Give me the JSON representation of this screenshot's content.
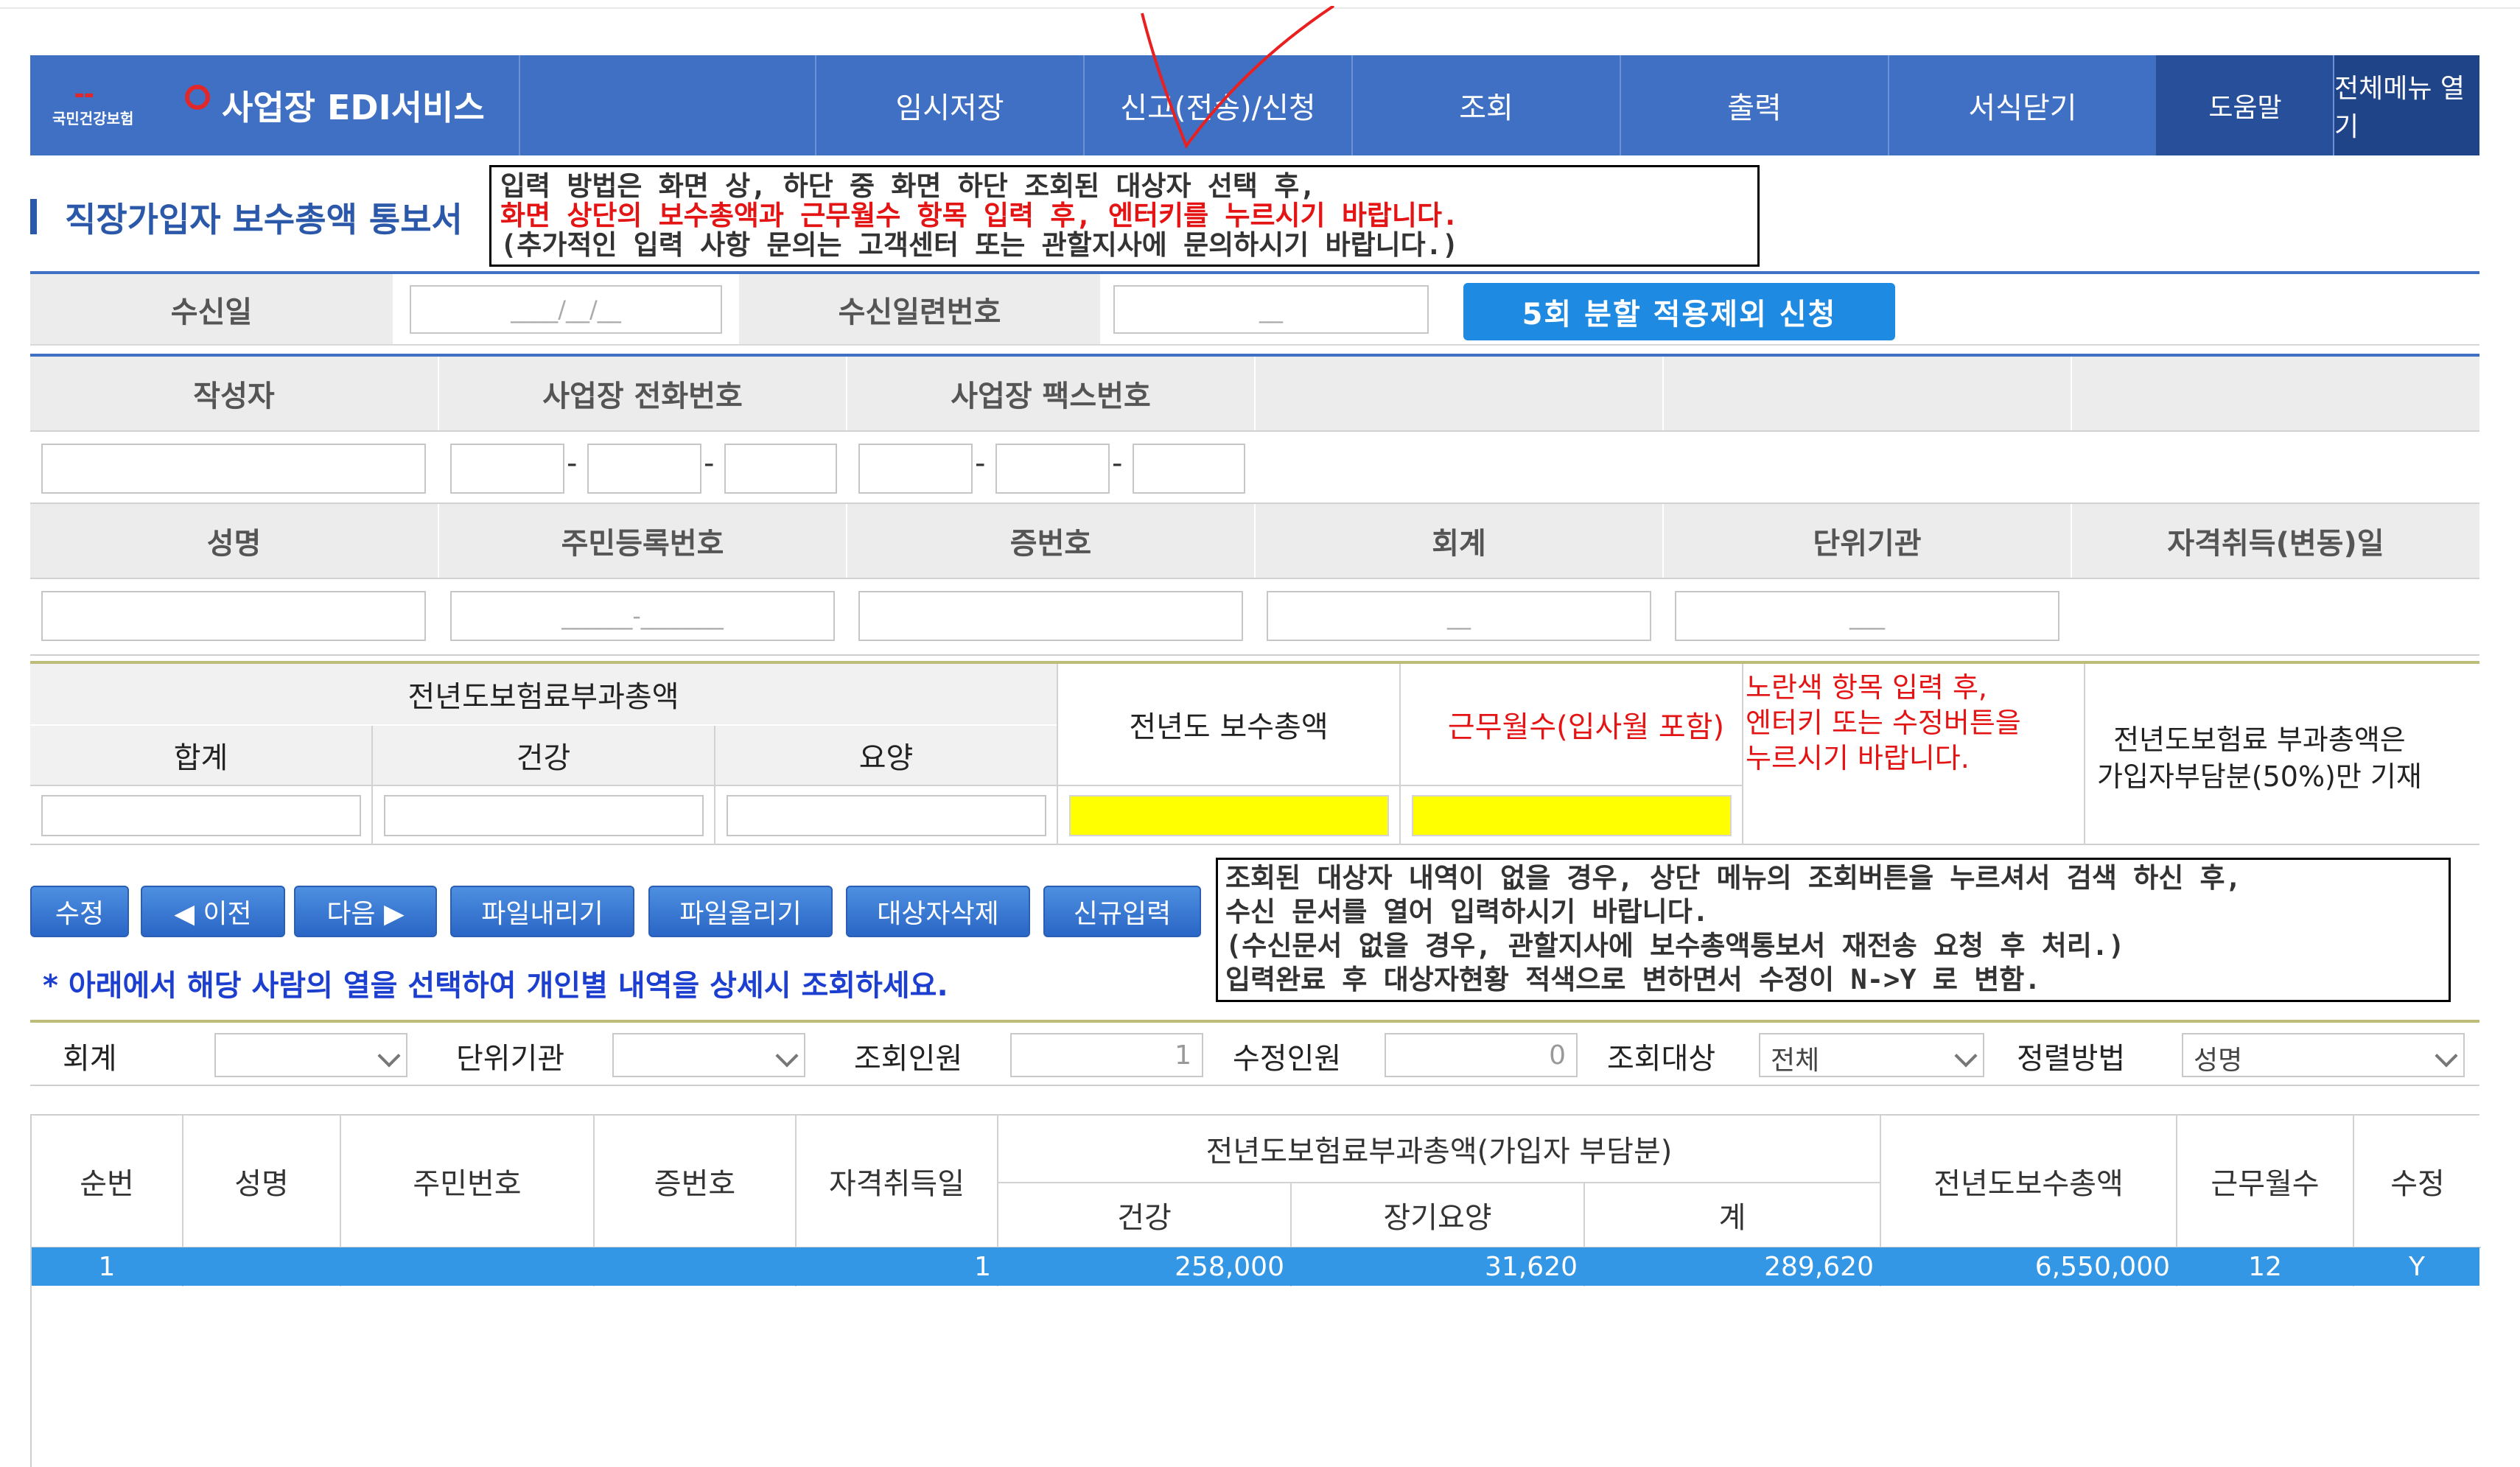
{
  "header": {
    "logo_text": "국민건강보험",
    "app_title": "사업장 EDI서비스",
    "menu": [
      "임시저장",
      "신고(전송)/신청",
      "조회",
      "출력",
      "서식닫기"
    ],
    "help": "도움말",
    "all_menu": "전체메뉴 열기"
  },
  "page": {
    "title": "직장가입자 보수총액 통보서"
  },
  "notice_top": {
    "line1": "입력 방법은 화면 상, 하단 중 화면 하단 조회된 대상자 선택 후,",
    "line2": "화면 상단의 보수총액과 근무월수 항목 입력 후, 엔터키를 누르시기 바랍니다.",
    "line3": "(추가적인 입력 사항 문의는 고객센터 또는 관할지사에 문의하시기 바랍니다.)"
  },
  "receipt": {
    "date_label": "수신일",
    "date_value": "____/__/__",
    "serial_label": "수신일련번호",
    "serial_value": "__",
    "split_button": "5회 분할 적용제외 신청"
  },
  "form": {
    "author_label": "작성자",
    "phone_label": "사업장 전화번호",
    "fax_label": "사업장 팩스번호",
    "dash": "-",
    "name_label": "성명",
    "rrn_label": "주민등록번호",
    "rrn_value": "______-_______",
    "cert_label": "증번호",
    "account_label": "회계",
    "account_value": "__",
    "unit_label": "단위기관",
    "unit_value": "___",
    "qual_label": "자격취득(변동)일"
  },
  "premium": {
    "group_label": "전년도보험료부과총액",
    "total_label": "합계",
    "health_label": "건강",
    "care_label": "요양",
    "salary_label": "전년도 보수총액",
    "months_label": "근무월수(입사월 포함)",
    "yellow_note": [
      "노란색 항목 입력 후,",
      "엔터키 또는 수정버튼을",
      "누르시기 바랍니다."
    ],
    "side_note": [
      "전년도보험료 부과총액은",
      "가입자부담분(50%)만 기재"
    ]
  },
  "buttons": {
    "edit": "수정",
    "prev": "◀ 이전",
    "next": "다음 ▶",
    "download": "파일내리기",
    "upload": "파일올리기",
    "delete": "대상자삭제",
    "new": "신규입력"
  },
  "select_note": "* 아래에서 해당 사람의 열을 선택하여 개인별 내역을 상세시 조회하세요.",
  "notice_bottom": {
    "line1": "조회된 대상자 내역이 없을 경우, 상단 메뉴의 조회버튼을 누르셔서 검색 하신 후,",
    "line2": "수신 문서를 열어 입력하시기 바랍니다.",
    "line3": "(수신문서 없을 경우, 관할지사에 보수총액통보서 재전송 요청 후 처리.)",
    "line4": "입력완료 후 대상자현황 적색으로 변하면서 수정이 N->Y 로 변함."
  },
  "filter": {
    "account_label": "회계",
    "unit_label": "단위기관",
    "count_label": "조회인원",
    "count_value": "1",
    "edited_label": "수정인원",
    "edited_value": "0",
    "target_label": "조회대상",
    "target_value": "전체",
    "sort_label": "정렬방법",
    "sort_value": "성명"
  },
  "table": {
    "headers": {
      "seq": "순번",
      "name": "성명",
      "rrn": "주민번호",
      "cert": "증번호",
      "qual_date": "자격취득일",
      "group": "전년도보험료부과총액(가입자 부담분)",
      "health": "건강",
      "ltc": "장기요양",
      "sum": "계",
      "salary": "전년도보수총액",
      "months": "근무월수",
      "edited": "수정"
    },
    "rows": [
      {
        "seq": "1",
        "name": "",
        "rrn": "",
        "cert": "",
        "qual_date": "1",
        "health": "258,000",
        "ltc": "31,620",
        "sum": "289,620",
        "salary": "6,550,000",
        "months": "12",
        "edited": "Y"
      }
    ]
  },
  "colors": {
    "header_blue": "#3f70c4",
    "selected_row": "#3497e5",
    "highlight_yellow": "#ffff00",
    "notice_red": "#e41414"
  }
}
